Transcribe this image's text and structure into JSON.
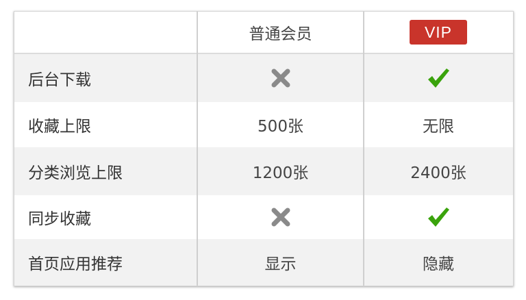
{
  "header": {
    "feature_col": "",
    "normal_col": "普通会员",
    "vip_col": "VIP"
  },
  "rows": [
    {
      "feature": "后台下载",
      "normal": "",
      "vip": "",
      "normal_icon": "cross-icon",
      "vip_icon": "check-icon"
    },
    {
      "feature": "收藏上限",
      "normal": "500张",
      "vip": "无限"
    },
    {
      "feature": "分类浏览上限",
      "normal": "1200张",
      "vip": "2400张"
    },
    {
      "feature": "同步收藏",
      "normal": "",
      "vip": "",
      "normal_icon": "cross-icon",
      "vip_icon": "check-icon"
    },
    {
      "feature": "首页应用推荐",
      "normal": "显示",
      "vip": "隐藏"
    }
  ],
  "colors": {
    "vip_badge": "#c9342b",
    "check": "#3aa30c",
    "cross": "#8a8a8a",
    "alt_row": "#f2f2f2"
  }
}
